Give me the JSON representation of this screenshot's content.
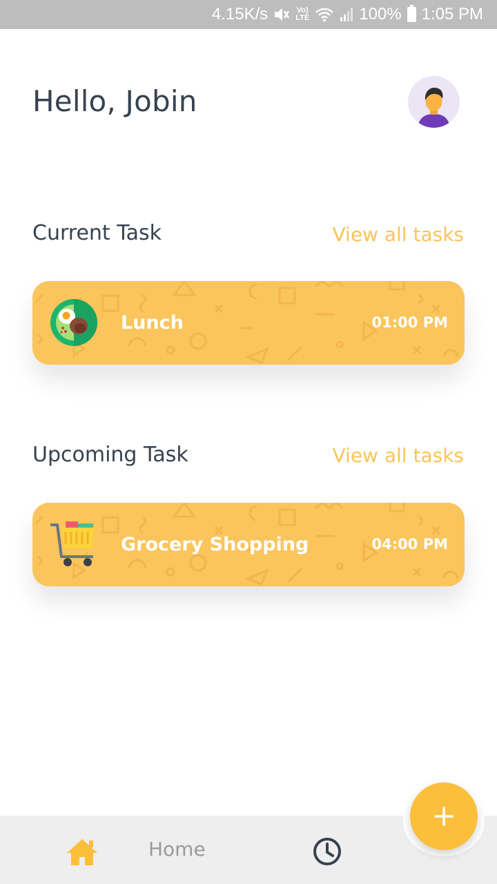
{
  "status_bar": {
    "speed": "4.15K/s",
    "volte_top": "Vo)",
    "volte_bottom": "LTE",
    "battery": "100%",
    "time": "1:05 PM"
  },
  "header": {
    "greeting": "Hello, Jobin"
  },
  "current_section": {
    "title": "Current Task",
    "view_all": "View all tasks",
    "task": {
      "title": "Lunch",
      "time": "01:00 PM",
      "icon": "lunch-plate-icon"
    }
  },
  "upcoming_section": {
    "title": "Upcoming Task",
    "view_all": "View all tasks",
    "task": {
      "title": "Grocery Shopping",
      "time": "04:00 PM",
      "icon": "shopping-cart-icon"
    }
  },
  "bottom_nav": {
    "home_label": "Home",
    "home_icon": "home-icon",
    "history_icon": "clock-icon"
  },
  "fab": {
    "icon": "plus-icon"
  },
  "colors": {
    "accent": "#fac55c",
    "link": "#fac459",
    "text": "#37424f",
    "fab": "#fbbf3c"
  }
}
